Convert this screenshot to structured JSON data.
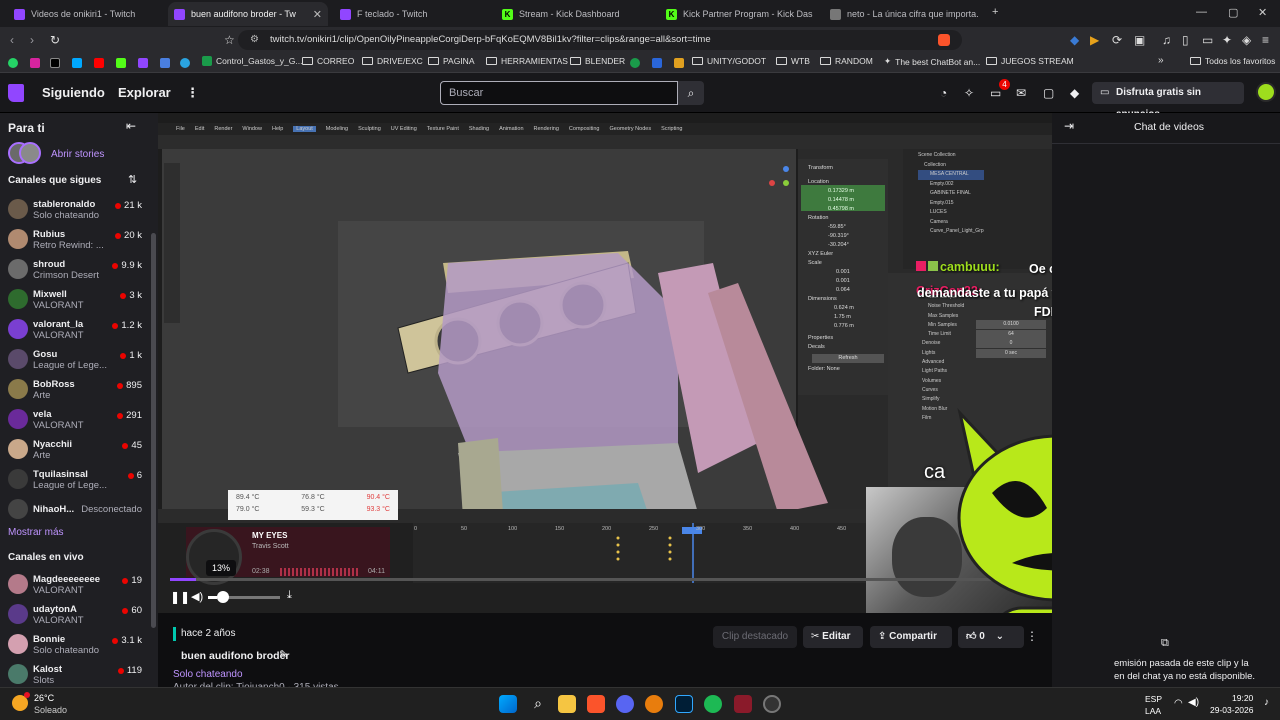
{
  "browser": {
    "tabs": [
      {
        "title": "Videos de onikiri1 - Twitch",
        "active": false
      },
      {
        "title": "buen audifono broder - Twitch",
        "active": true
      },
      {
        "title": "F teclado - Twitch",
        "active": false
      },
      {
        "title": "Stream - Kick Dashboard",
        "active": false
      },
      {
        "title": "Kick Partner Program - Kick Dashboard",
        "active": false
      },
      {
        "title": "neto - La única cifra que importa.",
        "active": false
      }
    ],
    "url": "twitch.tv/onikiri1/clip/OpenOilyPineappleCorgiDerp-bFqKoEQMV8Bil1kv?filter=clips&range=all&sort=time",
    "bookmarks": [
      "Control_Gastos_y_G...",
      "CORREO",
      "DRIVE/EXC",
      "PAGINA",
      "HERRAMIENTAS",
      "BLENDER",
      "UNITY/GODOT",
      "WTB",
      "RANDOM",
      "The best ChatBot an...",
      "JUEGOS STREAM",
      "Todos los favoritos"
    ]
  },
  "twitch": {
    "nav": {
      "following": "Siguiendo",
      "browse": "Explorar",
      "search_placeholder": "Buscar",
      "notif_count": "4",
      "turbo": "Disfruta gratis sin anuncios"
    },
    "sidebar": {
      "for_you": "Para ti",
      "stories": "Abrir stories",
      "followed_heading": "Canales que sigues",
      "followed": [
        {
          "name": "stableronaldo",
          "game": "Solo chateando",
          "viewers": "21 k",
          "color": "#6a5a4a"
        },
        {
          "name": "Rubius",
          "game": "Retro Rewind: ...",
          "viewers": "20 k",
          "color": "#b08a70"
        },
        {
          "name": "shroud",
          "game": "Crimson Desert",
          "viewers": "9.9 k",
          "color": "#6b6b6b"
        },
        {
          "name": "Mixwell",
          "game": "VALORANT",
          "viewers": "3 k",
          "color": "#2e6b2e"
        },
        {
          "name": "valorant_la",
          "game": "VALORANT",
          "viewers": "1.2 k",
          "color": "#7a3fd1"
        },
        {
          "name": "Gosu",
          "game": "League of Lege...",
          "viewers": "1 k",
          "color": "#5a4a6a"
        },
        {
          "name": "BobRoss",
          "game": "Arte",
          "viewers": "895",
          "color": "#8a7a4a"
        },
        {
          "name": "vela",
          "game": "VALORANT",
          "viewers": "291",
          "color": "#6a2a9a"
        },
        {
          "name": "Nyacchii",
          "game": "Arte",
          "viewers": "45",
          "color": "#c9a88a"
        },
        {
          "name": "Tquilasinsal",
          "game": "League of Lege...",
          "viewers": "6",
          "color": "#3a3a3a"
        },
        {
          "name": "NihaoH...",
          "game": "",
          "viewers": "Desconectado",
          "color": "#444"
        }
      ],
      "show_more": "Mostrar más",
      "live_heading": "Canales en vivo",
      "live": [
        {
          "name": "Magdeeeeeeee",
          "game": "VALORANT",
          "viewers": "19",
          "color": "#b47a8a"
        },
        {
          "name": "udaytonA",
          "game": "VALORANT",
          "viewers": "60",
          "color": "#5a3a8a"
        },
        {
          "name": "Bonnie",
          "game": "Solo chateando",
          "viewers": "3.1 k",
          "color": "#d4a0b0"
        },
        {
          "name": "Kalost",
          "game": "Slots",
          "viewers": "119",
          "color": "#4a7a6a"
        }
      ]
    },
    "player": {
      "volume_percent": "13%",
      "volume_level": 0.13,
      "song_title": "MY EYES",
      "song_artist": "Travis Scott",
      "song_elapsed": "02:38",
      "song_total": "04:11",
      "temps": [
        [
          "89.4 °C",
          "76.8 °C",
          "90.4 °C"
        ],
        [
          "79.0 °C",
          "59.3 °C",
          "93.3 °C"
        ]
      ],
      "webcam_caption": "ca",
      "overlay_chat": [
        {
          "user": "cambuuu:",
          "msg": "Oe cris como es eso que demandaste a tu papá wn"
        },
        {
          "user": "CrizCon22:",
          "msg": "FDKJSDFJKS"
        }
      ],
      "blender_menus": [
        "File",
        "Edit",
        "Render",
        "Window",
        "Help",
        "Layout",
        "Modeling",
        "Sculpting",
        "UV Editing",
        "Texture Paint",
        "Shading",
        "Animation",
        "Rendering",
        "Compositing",
        "Geometry Nodes",
        "Scripting"
      ],
      "blender_timeline_ticks": [
        "0",
        "50",
        "100",
        "150",
        "200",
        "250",
        "300",
        "350",
        "400",
        "450"
      ],
      "blender_outliner": [
        "Scene Collection",
        "Collection",
        "MESA CENTRAL",
        "Empty.002",
        "GABINETE FINAL",
        "Empty.015",
        "LUCES",
        "Camera",
        "Curve_Panel_Light_Grp"
      ],
      "blender_transform": {
        "title": "Transform",
        "location": "Location",
        "rotation": "Rotation",
        "scale": "Scale",
        "dimensions": "Dimensions",
        "loc": [
          "0.17329 m",
          "0.14478 m",
          "0.45798 m"
        ],
        "rot": [
          "-59.85°",
          "-90.319°",
          "-30.204°"
        ],
        "euler": "XYZ Euler",
        "scl": [
          "0.001",
          "0.001",
          "0.064"
        ],
        "dim": [
          "0.624 m",
          "1.75 m",
          "0.776 m"
        ],
        "properties": "Properties",
        "decals": "Decals",
        "refresh": "Refresh",
        "folder": "Folder:",
        "folder_val": "None"
      },
      "blender_render": [
        "Start Sample",
        "Noise Threshold",
        "Max Samples",
        "Min Samples",
        "Time Limit",
        "Denoise",
        "Lights",
        "Advanced",
        "Light Paths",
        "Volumes",
        "Curves",
        "Simplify",
        "Motion Blur",
        "Film"
      ],
      "blender_render_vals": [
        "0.0100",
        "64",
        "0",
        "0 sec"
      ]
    },
    "clip_info": {
      "age": "hace 2 años",
      "title": "buen audifono broder",
      "category": "Solo chateando",
      "author_line": "Autor del clip: Tiojuanch0 · 315 vistas",
      "featured": "Clip destacado",
      "edit": "Editar",
      "share": "Compartir",
      "likes": "0"
    },
    "chat": {
      "title": "Chat de videos",
      "notice": "emisión pasada de este clip y la\nen del chat ya no está disponible."
    }
  },
  "taskbar": {
    "weather_temp": "26°C",
    "weather_desc": "Soleado",
    "lang": "ESP",
    "lang2": "LAA",
    "time": "19:20",
    "date": "29-03-2026"
  }
}
